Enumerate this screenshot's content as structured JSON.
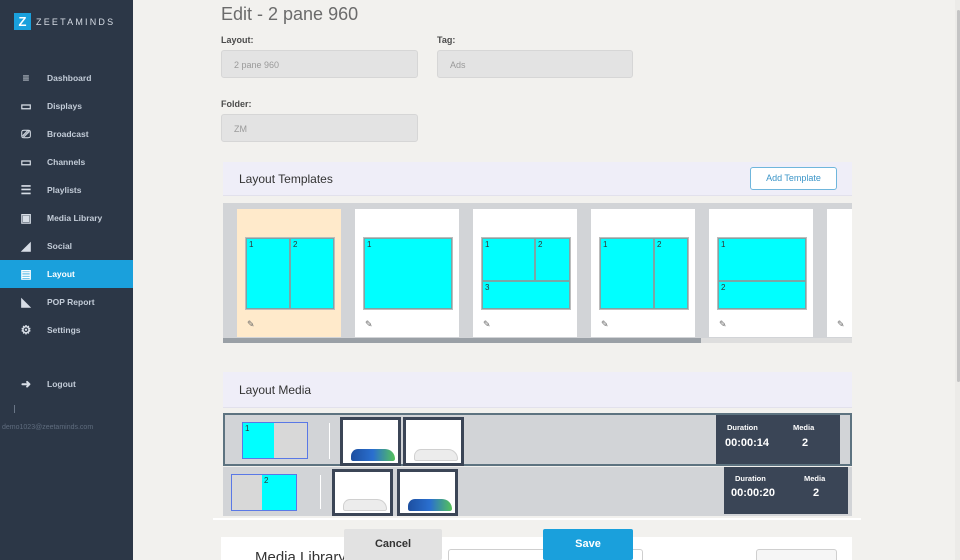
{
  "app": {
    "logo_letter": "Z",
    "brand": "ZEETAMINDS",
    "accent_color": "#1aa0dc",
    "sidebar_bg": "#2c3747"
  },
  "sidebar": {
    "items": [
      {
        "label": "Dashboard",
        "icon": "menu-icon"
      },
      {
        "label": "Displays",
        "icon": "monitor-icon"
      },
      {
        "label": "Broadcast",
        "icon": "video-camera-icon"
      },
      {
        "label": "Channels",
        "icon": "monitor-icon"
      },
      {
        "label": "Playlists",
        "icon": "list-icon"
      },
      {
        "label": "Media Library",
        "icon": "image-icon"
      },
      {
        "label": "Social",
        "icon": "rss-icon"
      },
      {
        "label": "Layout",
        "icon": "layout-icon",
        "active": true
      },
      {
        "label": "POP Report",
        "icon": "area-chart-icon"
      },
      {
        "label": "Settings",
        "icon": "gear-icon"
      }
    ],
    "logout": "Logout",
    "user_email": "demo1023@zeetaminds.com"
  },
  "page": {
    "title": "Edit - 2 pane 960"
  },
  "form": {
    "layout_label": "Layout:",
    "layout_value": "2 pane 960",
    "tag_label": "Tag:",
    "tag_value": "Ads",
    "folder_label": "Folder:",
    "folder_value": "ZM"
  },
  "templates_panel": {
    "title": "Layout Templates",
    "add_button": "Add Template",
    "templates": [
      {
        "zones": [
          "1",
          "2"
        ],
        "selected": true
      },
      {
        "zones": [
          "1"
        ]
      },
      {
        "zones": [
          "1",
          "2",
          "3"
        ]
      },
      {
        "zones": [
          "1",
          "2"
        ]
      },
      {
        "zones": [
          "1",
          "2"
        ]
      },
      {
        "zones": []
      }
    ]
  },
  "media_panel": {
    "title": "Layout Media",
    "rows": [
      {
        "zone": "1",
        "duration_label": "Duration",
        "duration": "00:00:14",
        "media_label": "Media",
        "media_count": "2"
      },
      {
        "zone": "2",
        "duration_label": "Duration",
        "duration": "00:00:20",
        "media_label": "Media",
        "media_count": "2"
      }
    ]
  },
  "media_library": {
    "title": "Media Library"
  },
  "actions": {
    "cancel": "Cancel",
    "save": "Save"
  }
}
